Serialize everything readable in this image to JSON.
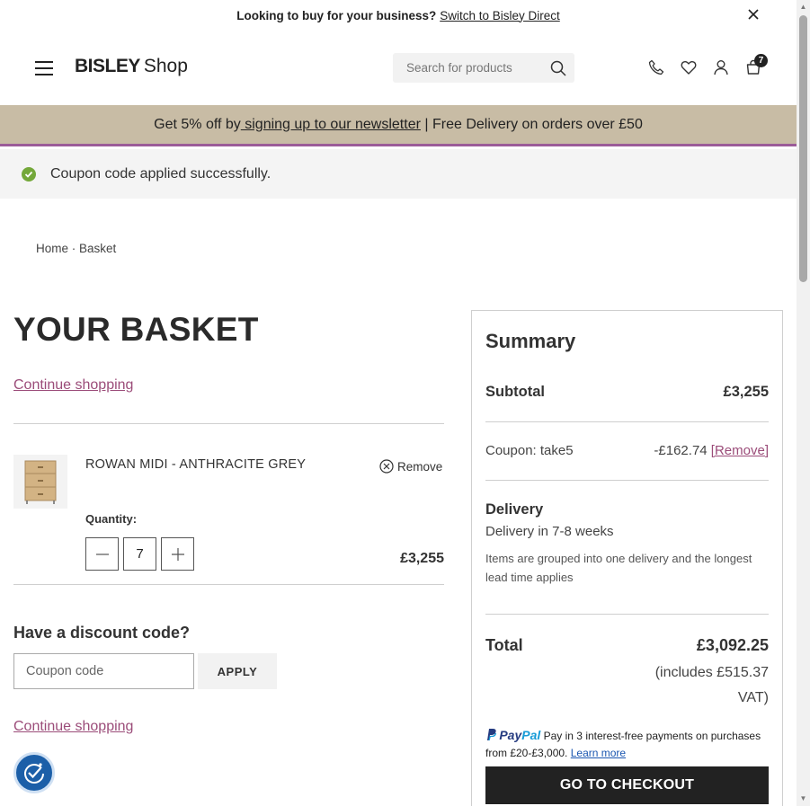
{
  "topbar": {
    "prompt": "Looking to buy for your business?",
    "link": "Switch to Bisley Direct"
  },
  "header": {
    "brand": "BISLEY",
    "shop": "Shop",
    "search_placeholder": "Search for products",
    "cart_count": "7"
  },
  "promo": {
    "before": "Get 5% off by",
    "link": " signing up to our newsletter",
    "after": " | Free Delivery on orders over £50"
  },
  "notice": {
    "message": "Coupon code applied successfully."
  },
  "breadcrumb": {
    "home": "Home",
    "separator": " · ",
    "current": "Basket"
  },
  "basket": {
    "title": "YOUR BASKET",
    "continue_label": "Continue shopping",
    "item": {
      "name": "ROWAN MIDI - ANTHRACITE GREY",
      "remove_label": "Remove",
      "quantity_label": "Quantity:",
      "quantity": "7",
      "price": "£3,255"
    },
    "discount_title": "Have a discount code?",
    "coupon_placeholder": "Coupon code",
    "apply_label": "APPLY"
  },
  "summary": {
    "title": "Summary",
    "subtotal_label": "Subtotal",
    "subtotal_value": "£3,255",
    "coupon_label": "Coupon: take5",
    "coupon_value": "-£162.74",
    "coupon_remove": "[Remove]",
    "delivery_label": "Delivery",
    "delivery_time": "Delivery in 7-8 weeks",
    "delivery_note": "Items are grouped into one delivery and the longest lead time applies",
    "total_label": "Total",
    "total_value": "£3,092.25",
    "vat_note": "(includes £515.37 VAT)",
    "paypal_brand_1": "Pay",
    "paypal_brand_2": "Pal",
    "paypal_text": "Pay in 3 interest-free payments on purchases from £20-£3,000.",
    "paypal_link": "Learn more",
    "checkout_label": "GO TO CHECKOUT"
  },
  "colors": {
    "promo_bg": "#c8bca5",
    "promo_border": "#9b5c98",
    "link_accent": "#9b4c79",
    "success": "#74a83a",
    "checkout_bg": "#222222",
    "a11y_bg": "#1c5fa8"
  },
  "icons": [
    "close-icon",
    "menu-icon",
    "search-icon",
    "phone-icon",
    "heart-icon",
    "account-icon",
    "cart-icon",
    "check-icon",
    "remove-circle-icon",
    "minus-icon",
    "plus-icon",
    "accessibility-icon",
    "paypal-icon"
  ]
}
